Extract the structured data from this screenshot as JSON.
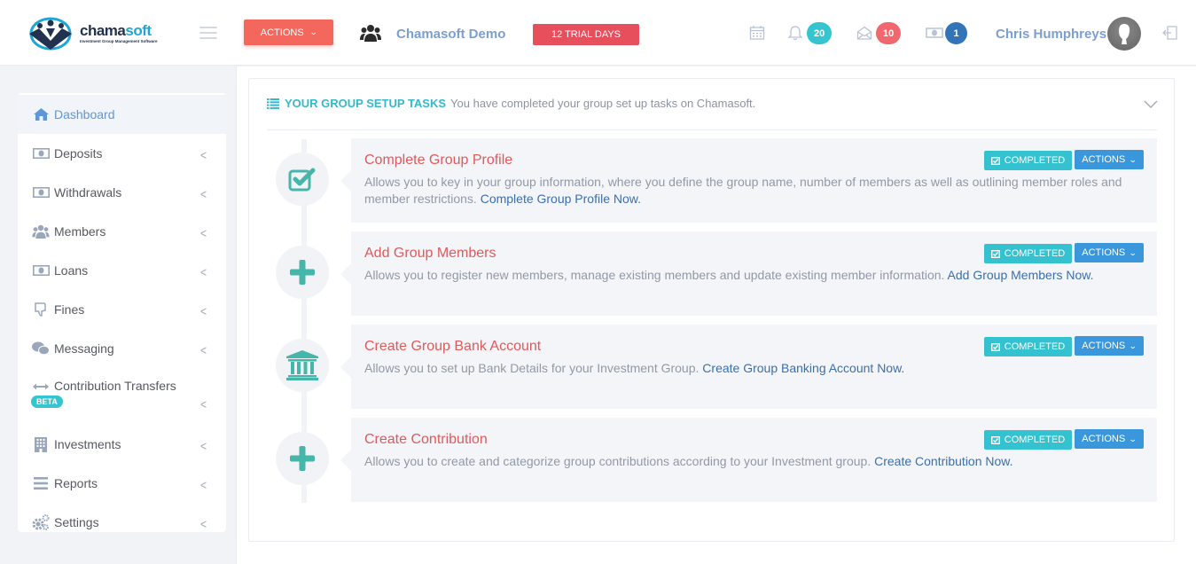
{
  "header": {
    "logo": {
      "name_part1": "chama",
      "name_part2": "soft",
      "tagline": "Investment Group Management Software"
    },
    "actions_label": "ACTIONS",
    "group_name": "Chamasoft Demo",
    "trial_badge": "12 TRIAL DAYS",
    "notifications": {
      "icon": "bell-icon",
      "count": "20",
      "color": "#36c4d0"
    },
    "messages": {
      "icon": "envelope-open-icon",
      "count": "10",
      "color": "#f0686e"
    },
    "payments": {
      "icon": "money-icon",
      "count": "1",
      "color": "#3374b8"
    },
    "user_name": "Chris Humphreys"
  },
  "sidebar": {
    "items": [
      {
        "label": "Dashboard",
        "icon": "home-icon",
        "active": true
      },
      {
        "label": "Deposits",
        "icon": "money-icon"
      },
      {
        "label": "Withdrawals",
        "icon": "money-icon"
      },
      {
        "label": "Members",
        "icon": "users-icon"
      },
      {
        "label": "Loans",
        "icon": "money-icon"
      },
      {
        "label": "Fines",
        "icon": "thumbs-down-icon"
      },
      {
        "label": "Messaging",
        "icon": "wechat-icon"
      },
      {
        "label": "Contribution Transfers",
        "icon": "arrows-h-icon",
        "badge": "BETA"
      },
      {
        "label": "Investments",
        "icon": "building-icon"
      },
      {
        "label": "Reports",
        "icon": "bars-icon"
      },
      {
        "label": "Settings",
        "icon": "cogs-icon"
      }
    ]
  },
  "setup": {
    "title": "YOUR GROUP SETUP TASKS",
    "subtitle": "You have completed your group set up tasks on Chamasoft.",
    "tasks": [
      {
        "title": "Complete Group Profile",
        "description": "Allows you to key in your group information, where you define the group name, number of members as well as outlining member roles and member restrictions.",
        "link": "Complete Group Profile Now.",
        "status": "COMPLETED",
        "actions": "ACTIONS",
        "icon": "check-square-icon"
      },
      {
        "title": "Add Group Members",
        "description": "Allows you to register new members, manage existing members and update existing member information.",
        "link": "Add Group Members Now.",
        "status": "COMPLETED",
        "actions": "ACTIONS",
        "icon": "plus-icon"
      },
      {
        "title": "Create Group Bank Account",
        "description": "Allows you to set up Bank Details for your Investment Group.",
        "link": "Create Group Banking Account Now.",
        "status": "COMPLETED",
        "actions": "ACTIONS",
        "icon": "bank-icon"
      },
      {
        "title": "Create Contribution",
        "description": "Allows you to create and categorize group contributions according to your Investment group.",
        "link": "Create Contribution Now.",
        "status": "COMPLETED",
        "actions": "ACTIONS",
        "icon": "plus-icon"
      }
    ]
  }
}
